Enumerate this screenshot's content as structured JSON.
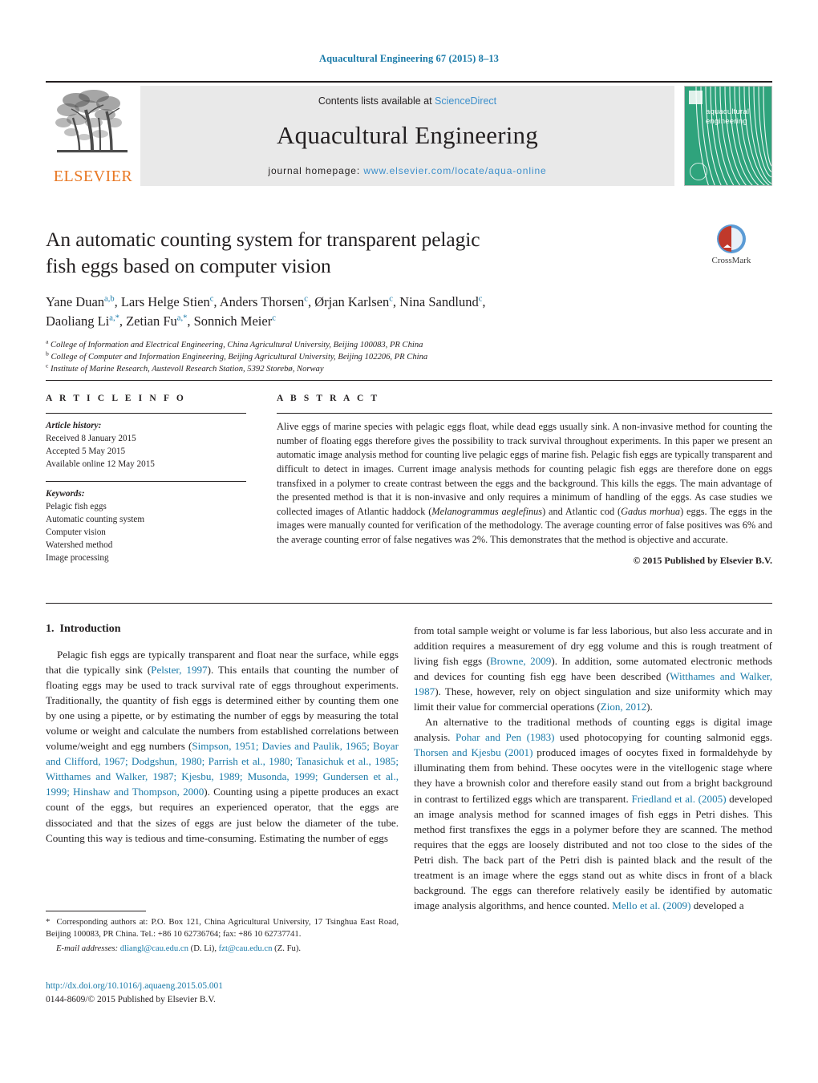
{
  "running_head": "Aquacultural Engineering 67 (2015) 8–13",
  "masthead": {
    "contents_prefix": "Contents lists available at ",
    "sciencedirect": "ScienceDirect",
    "journal_title": "Aquacultural Engineering",
    "homepage_label": "journal homepage:",
    "homepage_url": "www.elsevier.com/locate/aqua-online",
    "publisher_wordmark": "ELSEVIER",
    "cover_line1": "aquacultural",
    "cover_line2": "engineering",
    "accent_teal": "#2FA37C",
    "accent_orange": "#E87722",
    "accent_link": "#3C8FCB"
  },
  "article": {
    "title": "An automatic counting system for transparent pelagic fish eggs based on computer vision",
    "title_line1": "An automatic counting system for transparent pelagic",
    "title_line2": "fish eggs based on computer vision",
    "crossmark_label": "CrossMark",
    "authors": [
      {
        "name": "Yane Duan",
        "marks": "a,b",
        "sep": ", "
      },
      {
        "name": "Lars Helge Stien",
        "marks": "c",
        "sep": ", "
      },
      {
        "name": "Anders Thorsen",
        "marks": "c",
        "sep": ", "
      },
      {
        "name": "Ørjan Karlsen",
        "marks": "c",
        "sep": ", "
      },
      {
        "name": "Nina Sandlund",
        "marks": "c",
        "sep": ", "
      },
      {
        "name": "Daoliang Li",
        "marks": "a,*",
        "sep": ", "
      },
      {
        "name": "Zetian Fu",
        "marks": "a,*",
        "sep": ", "
      },
      {
        "name": "Sonnich Meier",
        "marks": "c",
        "sep": ""
      }
    ],
    "affiliations": [
      {
        "mark": "a",
        "text": "College of Information and Electrical Engineering, China Agricultural University, Beijing 100083, PR China"
      },
      {
        "mark": "b",
        "text": "College of Computer and Information Engineering, Beijing Agricultural University, Beijing 102206, PR China"
      },
      {
        "mark": "c",
        "text": "Institute of Marine Research, Austevoll Research Station, 5392 Storebø, Norway"
      }
    ]
  },
  "article_info": {
    "heading": "A R T I C L E    I N F O",
    "history_label": "Article history:",
    "history": [
      "Received 8 January 2015",
      "Accepted 5 May 2015",
      "Available online 12 May 2015"
    ],
    "keywords_label": "Keywords:",
    "keywords": [
      "Pelagic fish eggs",
      "Automatic counting system",
      "Computer vision",
      "Watershed method",
      "Image processing"
    ]
  },
  "abstract": {
    "heading": "A B S T R A C T",
    "part1": "Alive eggs of marine species with pelagic eggs float, while dead eggs usually sink. A non-invasive method for counting the number of floating eggs therefore gives the possibility to track survival throughout experiments. In this paper we present an automatic image analysis method for counting live pelagic eggs of marine fish. Pelagic fish eggs are typically transparent and difficult to detect in images. Current image analysis methods for counting pelagic fish eggs are therefore done on eggs transfixed in a polymer to create contrast between the eggs and the background. This kills the eggs. The main advantage of the presented method is that it is non-invasive and only requires a minimum of handling of the eggs. As case studies we collected images of Atlantic haddock (",
    "species1": "Melanogrammus aeglefinus",
    "part2": ") and Atlantic cod (",
    "species2": "Gadus morhua",
    "part3": ") eggs. The eggs in the images were manually counted for verification of the methodology. The average counting error of false positives was 6% and the average counting error of false negatives was 2%. This demonstrates that the method is objective and accurate.",
    "copyright": "© 2015 Published by Elsevier B.V."
  },
  "introduction": {
    "section_number": "1.",
    "section_title": "Introduction",
    "left_p1_a": "Pelagic fish eggs are typically transparent and float near the surface, while eggs that die typically sink (",
    "left_p1_cite1": "Pelster, 1997",
    "left_p1_b": "). This entails that counting the number of floating eggs may be used to track survival rate of eggs throughout experiments. Traditionally, the quantity of fish eggs is determined either by counting them one by one using a pipette, or by estimating the number of eggs by measuring the total volume or weight and calculate the numbers from established correlations between volume/weight and egg numbers (",
    "left_p1_cite2": "Simpson, 1951; Davies and Paulik, 1965; Boyar and Clifford, 1967; Dodgshun, 1980; Parrish et al., 1980; Tanasichuk et al., 1985; Witthames and Walker, 1987; Kjesbu, 1989; Musonda, 1999; Gundersen et al., 1999; Hinshaw and Thompson, 2000",
    "left_p1_c": "). Counting using a pipette produces an exact count of the eggs, but requires an experienced operator, that the eggs are dissociated and that the sizes of eggs are just below the diameter of the tube. Counting this way is tedious and time-consuming. Estimating the number of eggs",
    "right_p1_a": "from total sample weight or volume is far less laborious, but also less accurate and in addition requires a measurement of dry egg volume and this is rough treatment of living fish eggs (",
    "right_p1_cite1": "Browne, 2009",
    "right_p1_b": "). In addition, some automated electronic methods and devices for counting fish egg have been described (",
    "right_p1_cite2": "Witthames and Walker, 1987",
    "right_p1_c": "). These, however, rely on object singulation and size uniformity which may limit their value for commercial operations (",
    "right_p1_cite3": "Zion, 2012",
    "right_p1_d": ").",
    "right_p2_a": "An alternative to the traditional methods of counting eggs is digital image analysis. ",
    "right_p2_cite1": "Pohar and Pen (1983)",
    "right_p2_b": " used photocopying for counting salmonid eggs. ",
    "right_p2_cite2": "Thorsen and Kjesbu (2001)",
    "right_p2_c": " produced images of oocytes fixed in formaldehyde by illuminating them from behind. These oocytes were in the vitellogenic stage where they have a brownish color and therefore easily stand out from a bright background in contrast to fertilized eggs which are transparent. ",
    "right_p2_cite3": "Friedland et al. (2005)",
    "right_p2_d": " developed an image analysis method for scanned images of fish eggs in Petri dishes. This method first transfixes the eggs in a polymer before they are scanned. The method requires that the eggs are loosely distributed and not too close to the sides of the Petri dish. The back part of the Petri dish is painted black and the result of the treatment is an image where the eggs stand out as white discs in front of a black background. The eggs can therefore relatively easily be identified by automatic image analysis algorithms, and hence counted. ",
    "right_p2_cite4": "Mello et al. (2009)",
    "right_p2_e": " developed a"
  },
  "footnotes": {
    "corresponding": "Corresponding authors at: P.O. Box 121, China Agricultural University, 17 Tsinghua East Road, Beijing 100083, PR China. Tel.: +86 10 62736764; fax: +86 10 62737741.",
    "email_label": "E-mail addresses:",
    "email1": "dliangl@cau.edu.cn",
    "email1_owner": "(D. Li),",
    "email2": "fzt@cau.edu.cn",
    "email2_owner": "(Z. Fu).",
    "doi_url": "http://dx.doi.org/10.1016/j.aquaeng.2015.05.001",
    "issn_line": "0144-8609/© 2015 Published by Elsevier B.V."
  }
}
